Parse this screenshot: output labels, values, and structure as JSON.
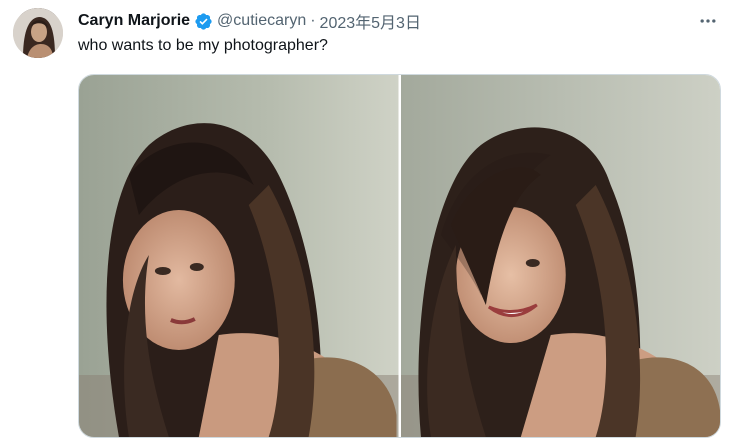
{
  "tweet": {
    "author_name": "Caryn Marjorie",
    "handle": "@cutiecaryn",
    "separator": "·",
    "date": "2023年5月3日",
    "text": "who wants to be my photographer?"
  },
  "icons": {
    "verified": "verified-badge-icon",
    "more": "more-options-icon"
  },
  "colors": {
    "verified_blue": "#1d9bf0",
    "text_primary": "#0f1419",
    "text_secondary": "#536471",
    "border": "#cfd9de"
  },
  "media": {
    "count": 2
  }
}
